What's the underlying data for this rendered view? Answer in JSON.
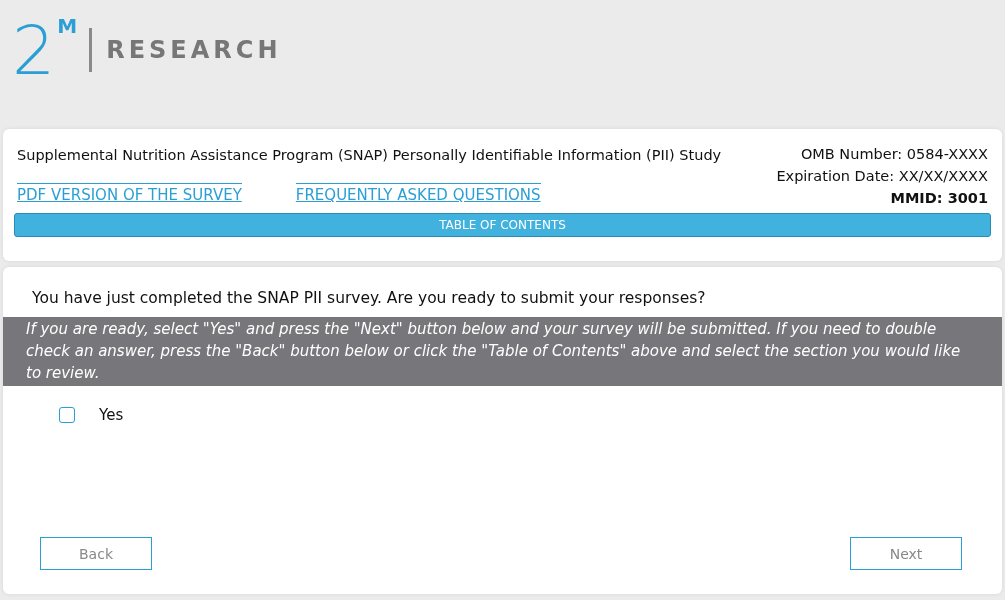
{
  "logo": {
    "numeral": "2",
    "superscript": "M",
    "name": "RESEARCH"
  },
  "header": {
    "study_title": "Supplemental Nutrition Assistance Program (SNAP) Personally Identifiable Information (PII) Study",
    "links": [
      "PDF VERSION OF THE SURVEY",
      "FREQUENTLY ASKED QUESTIONS"
    ],
    "omb_number": "OMB Number: 0584-XXXX",
    "expiration": "Expiration Date: XX/XX/XXXX",
    "mmid": "MMID: 3001",
    "toc_button": "TABLE OF CONTENTS"
  },
  "question": {
    "text": "You have just completed the SNAP PII survey. Are you ready to submit your responses?",
    "instructions": "If you are ready, select \"Yes\" and press the \"Next\" button below and your survey will be submitted. If you need to double check an answer, press the \"Back\" button below or click the \"Table of Contents\" above and select the section you would like to review.",
    "options": [
      {
        "label": "Yes",
        "checked": false
      }
    ]
  },
  "buttons": {
    "back": "Back",
    "next": "Next"
  }
}
